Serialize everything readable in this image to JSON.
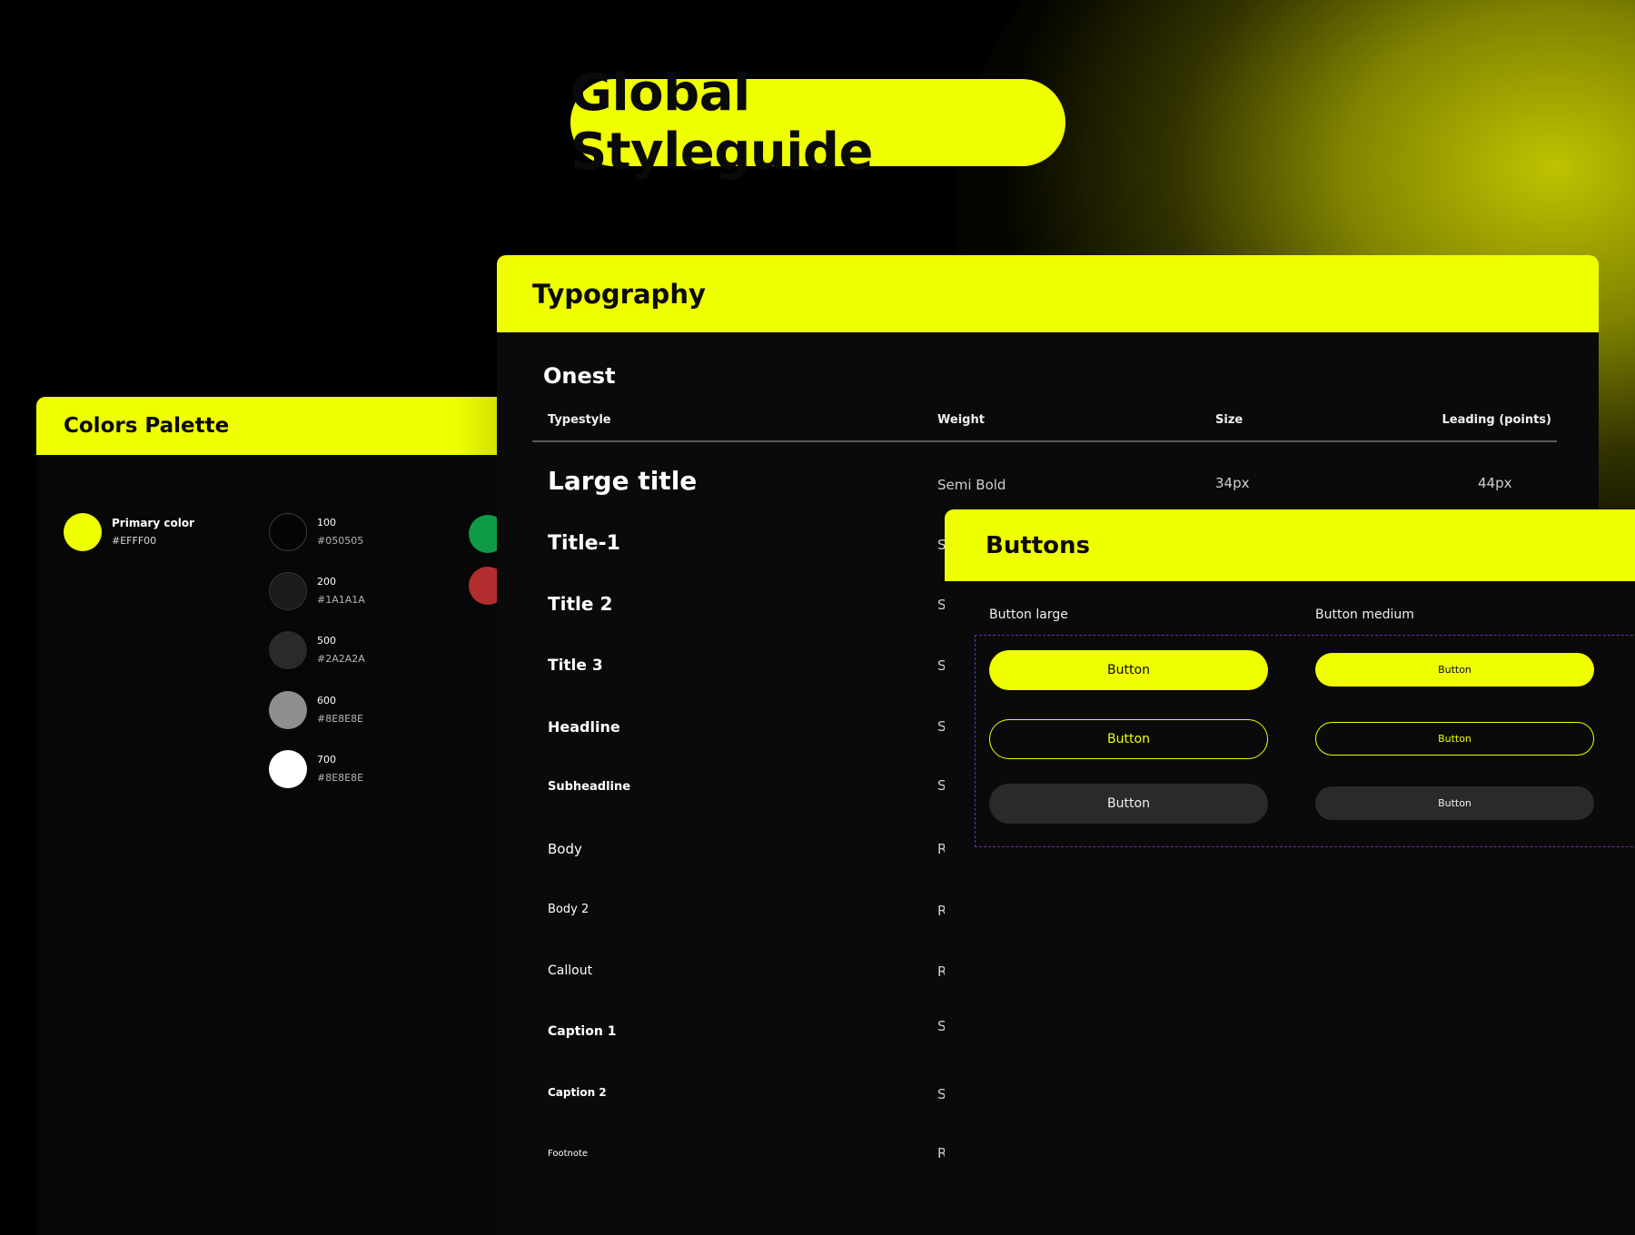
{
  "page_title": "Global Styleguide",
  "colors": {
    "title": "Colors Palette",
    "primary": {
      "name": "Primary color",
      "hex": "#EFFF00"
    },
    "neutrals": [
      {
        "name": "100",
        "hex": "#050505"
      },
      {
        "name": "200",
        "hex": "#1A1A1A"
      },
      {
        "name": "500",
        "hex": "#2A2A2A"
      },
      {
        "name": "600",
        "hex": "#8E8E8E"
      },
      {
        "name": "700",
        "hex": "#8E8E8E"
      }
    ],
    "accent_green": "#0f9a45",
    "accent_red": "#b22d2d"
  },
  "typography": {
    "title": "Typography",
    "font_name": "Onest",
    "columns": {
      "typestyle": "Typestyle",
      "weight": "Weight",
      "size": "Size",
      "leading": "Leading (points)"
    },
    "rows": [
      {
        "name": "Large title",
        "weight": "Semi Bold",
        "size": "34px",
        "leading": "44px"
      },
      {
        "name": "Title-1",
        "weight": "S"
      },
      {
        "name": "Title 2",
        "weight": "S"
      },
      {
        "name": "Title 3",
        "weight": "S"
      },
      {
        "name": "Headline",
        "weight": "S"
      },
      {
        "name": "Subheadline",
        "weight": "S"
      },
      {
        "name": "Body",
        "weight": "R"
      },
      {
        "name": "Body 2",
        "weight": "R"
      },
      {
        "name": "Callout",
        "weight": "R"
      },
      {
        "name": "Caption 1",
        "weight": "S"
      },
      {
        "name": "Caption 2",
        "weight": "S"
      },
      {
        "name": "Footnote",
        "weight": "R"
      }
    ]
  },
  "buttons": {
    "title": "Buttons",
    "large_label": "Button large",
    "medium_label": "Button medium",
    "large": [
      "Button",
      "Button",
      "Button"
    ],
    "medium": [
      "Button",
      "Button",
      "Button"
    ]
  }
}
